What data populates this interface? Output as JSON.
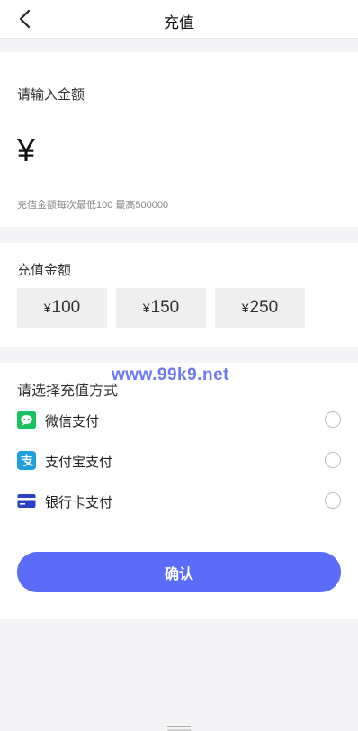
{
  "header": {
    "title": "充值"
  },
  "amount_input": {
    "label": "请输入金额",
    "currency_symbol": "¥",
    "hint": "充值金额每次最低100  最高500000"
  },
  "presets": {
    "label": "充值金额",
    "currency_symbol": "¥",
    "options": [
      {
        "value": "100"
      },
      {
        "value": "150"
      },
      {
        "value": "250"
      }
    ]
  },
  "payment": {
    "label": "请选择充值方式",
    "watermark": "www.99k9.net",
    "methods": [
      {
        "label": "微信支付",
        "icon": "wechat-pay-icon",
        "color": "#19c160",
        "selected": false
      },
      {
        "label": "支付宝支付",
        "icon": "alipay-icon",
        "color": "#1f9fe0",
        "selected": false
      },
      {
        "label": "银行卡支付",
        "icon": "bank-card-icon",
        "color": "#2741c7",
        "selected": false
      }
    ]
  },
  "confirm": {
    "label": "确认",
    "color": "#5b6df8"
  }
}
